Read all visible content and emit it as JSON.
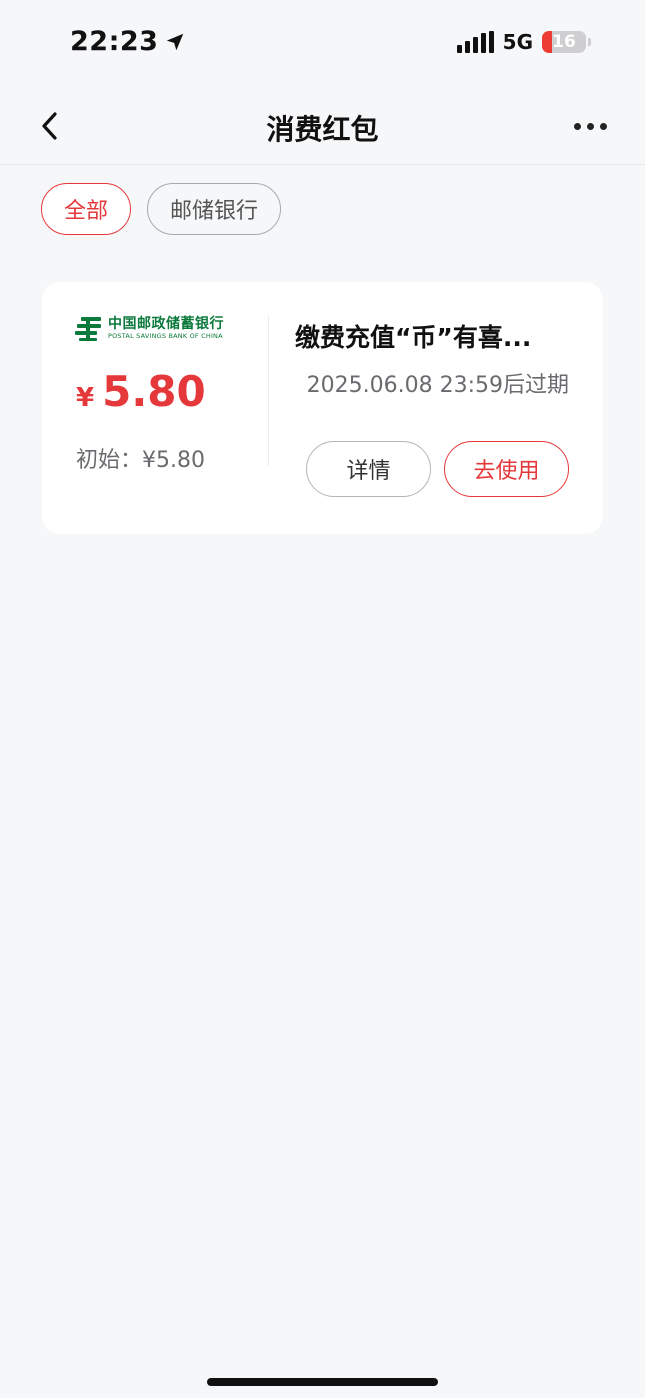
{
  "status_bar": {
    "time": "22:23",
    "network": "5G",
    "battery": "16"
  },
  "nav": {
    "title": "消费红包"
  },
  "filters": [
    {
      "label": "全部",
      "active": true
    },
    {
      "label": "邮储银行",
      "active": false
    }
  ],
  "card": {
    "bank_name_cn": "中国邮政储蓄银行",
    "bank_name_en": "POSTAL SAVINGS BANK OF CHINA",
    "currency_symbol": "¥",
    "amount": "5.80",
    "initial": "初始：¥5.80",
    "title": "缴费充值“币”有喜...",
    "expire": "2025.06.08 23:59后过期",
    "detail_button": "详情",
    "use_button": "去使用"
  },
  "colors": {
    "accent": "#e5383b",
    "background": "#f6f7f9",
    "bank_green": "#0b7a3c"
  },
  "icons": {
    "back": "chevron-left-icon",
    "more": "more-dots-icon",
    "location": "location-arrow-icon",
    "bank": "postal-bank-logo-icon"
  }
}
